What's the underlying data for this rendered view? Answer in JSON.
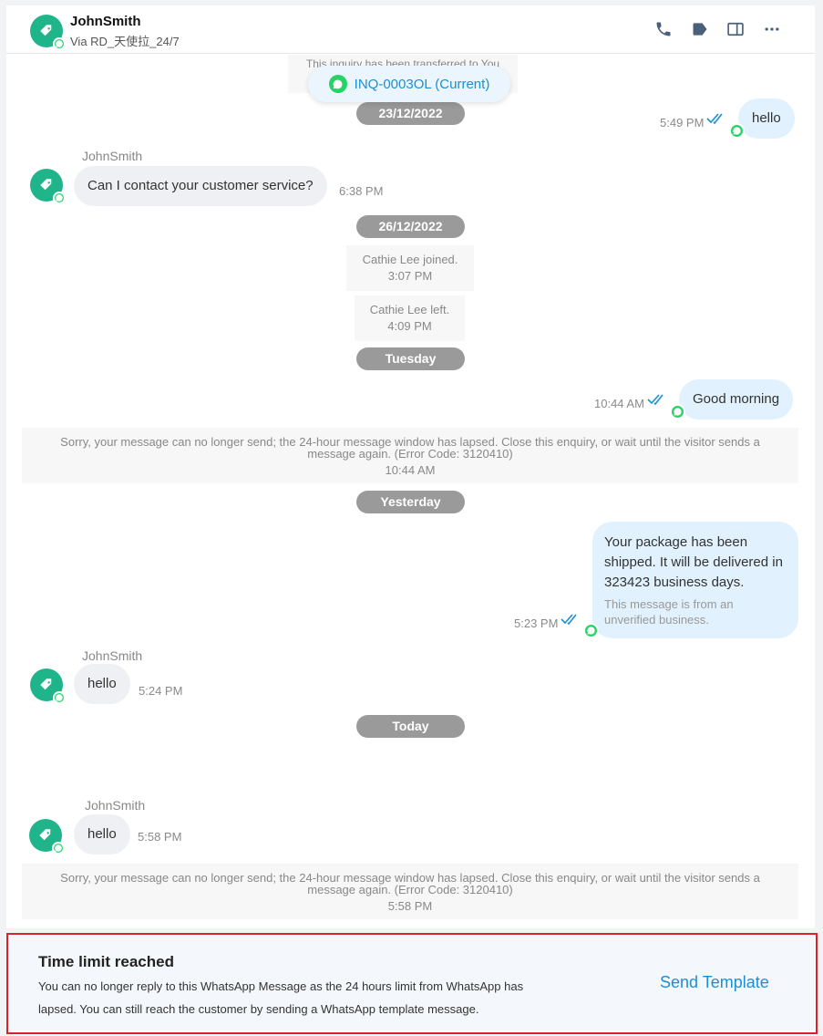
{
  "header": {
    "name": "JohnSmith",
    "via": "Via RD_天使拉_24/7",
    "icons": [
      "phone-icon",
      "tag-icon",
      "split-view-icon",
      "more-icon"
    ]
  },
  "transfer_note": "This inquiry has been transferred to You",
  "current_inquiry": "INQ-0003OL (Current)",
  "dates": {
    "d1": "23/12/2022",
    "d2": "26/12/2022",
    "d3": "Tuesday",
    "d4": "Yesterday",
    "d5": "Today"
  },
  "messages": {
    "out_hello": {
      "text": "hello",
      "time": "5:49 PM"
    },
    "in_contact": {
      "sender": "JohnSmith",
      "text": "Can I contact your customer service?",
      "time": "6:38 PM"
    },
    "event_joined": {
      "text": "Cathie Lee joined.",
      "time": "3:07 PM"
    },
    "event_left": {
      "text": "Cathie Lee left.",
      "time": "4:09 PM"
    },
    "out_morning": {
      "text": "Good morning",
      "time": "10:44 AM"
    },
    "error1": {
      "text": "Sorry, your message can no longer send; the 24-hour message window has lapsed. Close this enquiry, or wait until the visitor sends a message again. (Error Code: 3120410)",
      "time": "10:44 AM"
    },
    "out_package": {
      "text": "Your package has been shipped. It will be delivered in 323423 business days.",
      "note": "This message is from an unverified business.",
      "time": "5:23 PM"
    },
    "in_hello1": {
      "sender": "JohnSmith",
      "text": "hello",
      "time": "5:24 PM"
    },
    "in_hello2": {
      "sender": "JohnSmith",
      "text": "hello",
      "time": "5:58 PM"
    },
    "error2": {
      "text": "Sorry, your message can no longer send; the 24-hour message window has lapsed. Close this enquiry, or wait until the visitor sends a message again. (Error Code: 3120410)",
      "time": "5:58 PM"
    }
  },
  "footer": {
    "title": "Time limit reached",
    "text": "You can no longer reply to this WhatsApp Message as the 24 hours limit from WhatsApp has lapsed. You can still reach the customer by sending a WhatsApp template message.",
    "button": "Send Template"
  },
  "colors": {
    "accent": "#1a8fd6",
    "avatar": "#1fb48a",
    "whatsapp": "#25d366",
    "outgoing_bubble": "#e1f1fd",
    "incoming_bubble": "#eef0f3",
    "date_pill": "#9a9a9a",
    "alert_border": "#e01f2c"
  }
}
